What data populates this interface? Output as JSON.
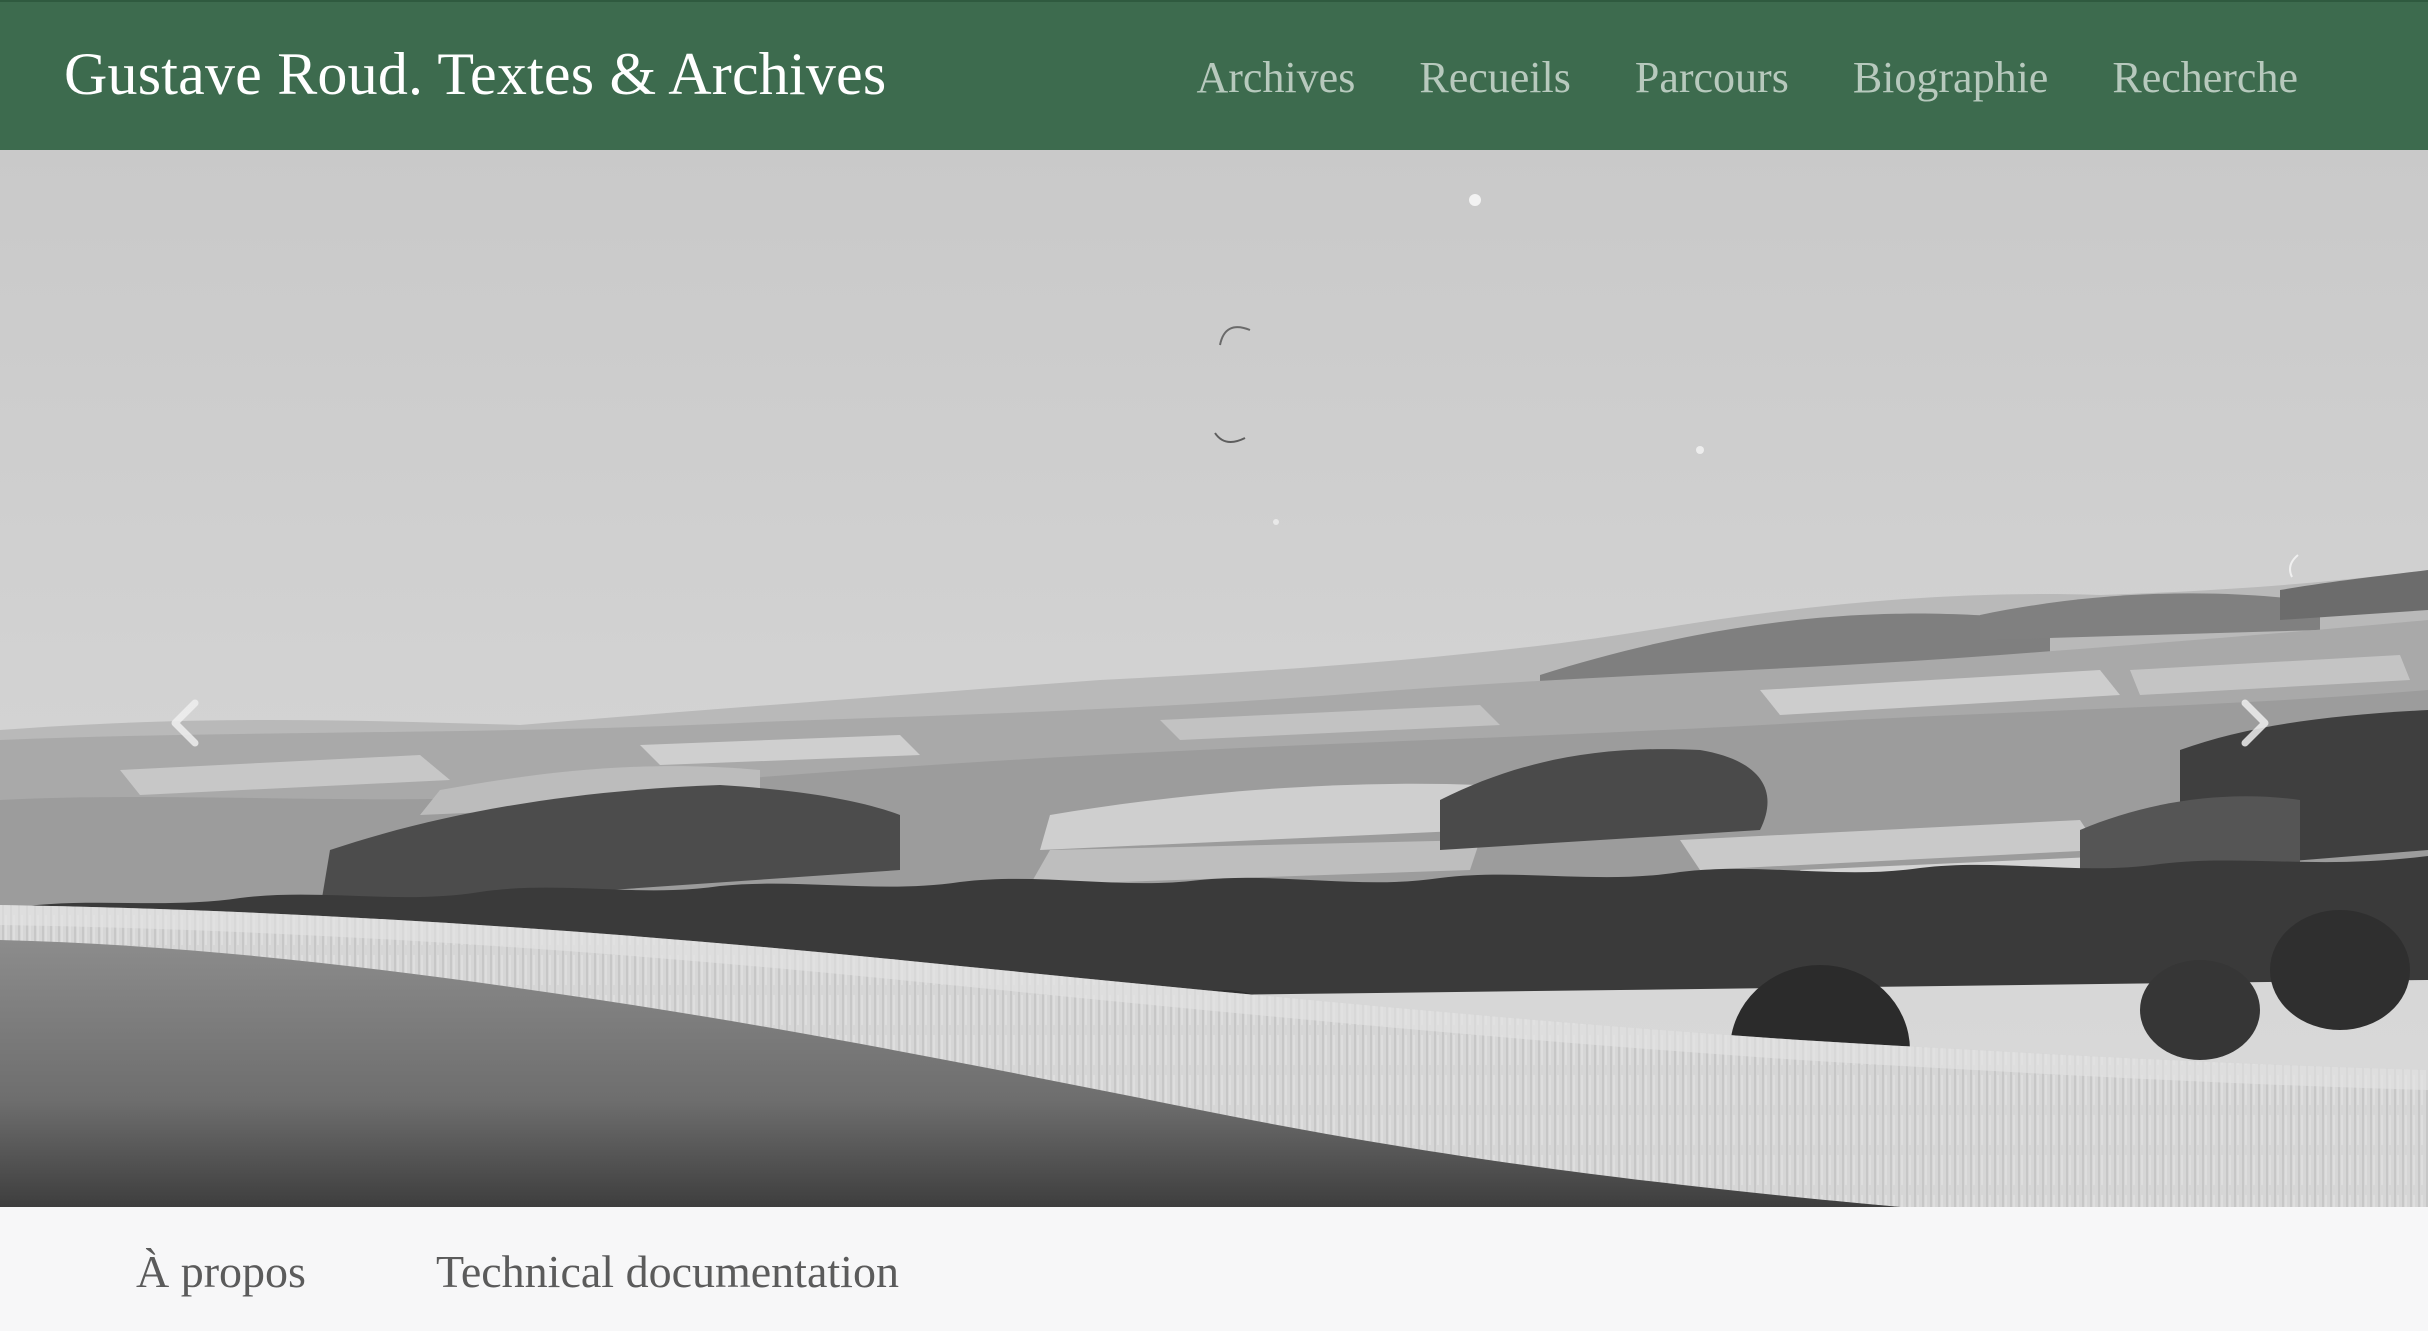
{
  "header": {
    "brand": "Gustave Roud. Textes & Archives",
    "background_color": "#3d6b4e",
    "brand_color": "#ffffff",
    "link_color": "#b7c9bd",
    "nav": [
      {
        "label": "Archives"
      },
      {
        "label": "Recueils"
      },
      {
        "label": "Parcours"
      },
      {
        "label": "Biographie"
      },
      {
        "label": "Recherche"
      }
    ]
  },
  "carousel": {
    "image": "black-and-white-countryside-landscape-photo",
    "controls": {
      "prev_icon": "chevron-left-icon",
      "next_icon": "chevron-right-icon"
    }
  },
  "footer": {
    "links": [
      {
        "label": "À propos"
      },
      {
        "label": "Technical documentation"
      }
    ]
  }
}
